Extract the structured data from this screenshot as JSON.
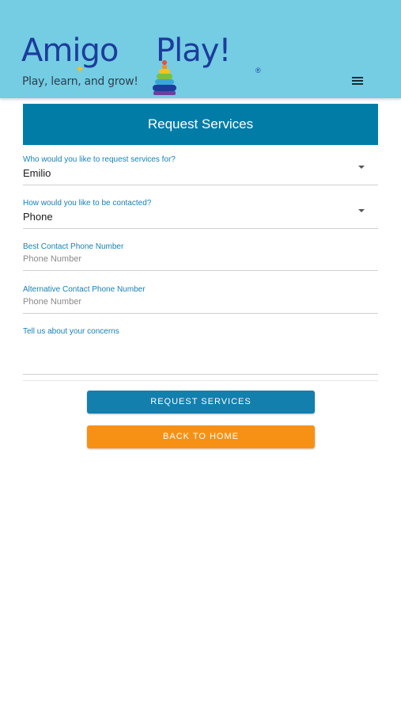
{
  "header": {
    "logo_left": "Amigo",
    "logo_right": "Play!",
    "logo_reg": "®",
    "tagline": "Play, learn, and grow!",
    "menu_icon": "hamburger-menu-icon"
  },
  "page": {
    "title": "Request Services"
  },
  "form": {
    "who": {
      "label": "Who would you like to request services for?",
      "value": "Emilio"
    },
    "contact_method": {
      "label": "How would you like to be contacted?",
      "value": "Phone"
    },
    "best_phone": {
      "label": "Best Contact Phone Number",
      "placeholder": "Phone Number"
    },
    "alt_phone": {
      "label": "Alternative Contact Phone Number",
      "placeholder": "Phone Number"
    },
    "concerns": {
      "label": "Tell us about your concerns",
      "value": ""
    }
  },
  "buttons": {
    "request": "REQUEST SERVICES",
    "back": "BACK TO HOME"
  },
  "colors": {
    "header_bg": "#74cde3",
    "brand_blue": "#1d3c9c",
    "banner_bg": "#007ca7",
    "primary_button": "#137fac",
    "secondary_button": "#f79116"
  }
}
